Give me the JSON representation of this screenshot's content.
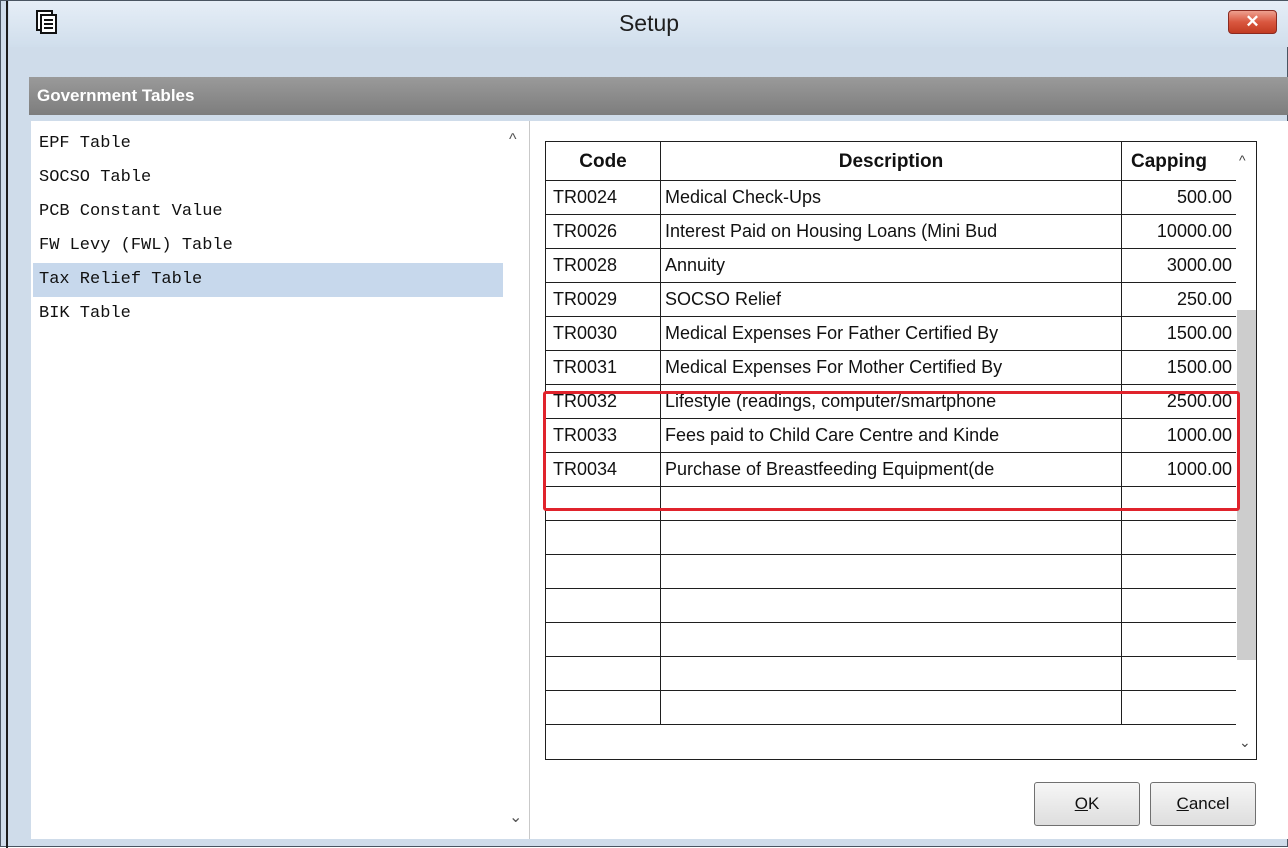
{
  "window": {
    "title": "Setup",
    "close_glyph": "✕",
    "icon": "setup-app-icon"
  },
  "section": {
    "header": "Government Tables"
  },
  "left_list": {
    "items": [
      {
        "label": "EPF Table"
      },
      {
        "label": "SOCSO Table"
      },
      {
        "label": "PCB Constant Value"
      },
      {
        "label": "FW Levy (FWL) Table"
      },
      {
        "label": "Tax Relief Table",
        "selected": true
      },
      {
        "label": "BIK Table"
      }
    ],
    "scroll_up_glyph": "^",
    "scroll_down_glyph": "⌄"
  },
  "grid": {
    "columns": {
      "code": "Code",
      "description": "Description",
      "capping": "Capping"
    },
    "rows": [
      {
        "code": "TR0024",
        "description": "Medical Check-Ups",
        "capping": "500.00"
      },
      {
        "code": "TR0026",
        "description": "Interest Paid on Housing Loans (Mini Bud",
        "capping": "10000.00"
      },
      {
        "code": "TR0028",
        "description": "Annuity",
        "capping": "3000.00"
      },
      {
        "code": "TR0029",
        "description": "SOCSO Relief",
        "capping": "250.00"
      },
      {
        "code": "TR0030",
        "description": "Medical Expenses For Father Certified By",
        "capping": "1500.00"
      },
      {
        "code": "TR0031",
        "description": "Medical Expenses For Mother Certified By",
        "capping": "1500.00"
      },
      {
        "code": "TR0032",
        "description": "Lifestyle (readings, computer/smartphone",
        "capping": "2500.00"
      },
      {
        "code": "TR0033",
        "description": "Fees paid to Child Care Centre and Kinde",
        "capping": "1000.00"
      },
      {
        "code": "TR0034",
        "description": "Purchase of Breastfeeding Equipment(de",
        "capping": "1000.00"
      },
      {
        "code": "",
        "description": "",
        "capping": ""
      },
      {
        "code": "",
        "description": "",
        "capping": ""
      },
      {
        "code": "",
        "description": "",
        "capping": ""
      },
      {
        "code": "",
        "description": "",
        "capping": ""
      },
      {
        "code": "",
        "description": "",
        "capping": ""
      },
      {
        "code": "",
        "description": "",
        "capping": ""
      },
      {
        "code": "",
        "description": "",
        "capping": ""
      }
    ],
    "scroll_up_glyph": "^",
    "scroll_down_glyph": "⌄"
  },
  "highlight": {
    "color": "#e0232c"
  },
  "buttons": {
    "ok_mnemonic": "O",
    "ok_rest": "K",
    "cancel_mnemonic": "C",
    "cancel_rest": "ancel"
  },
  "colors": {
    "selection": "#c7d8ec",
    "header_bar": "#8a8a8a"
  }
}
